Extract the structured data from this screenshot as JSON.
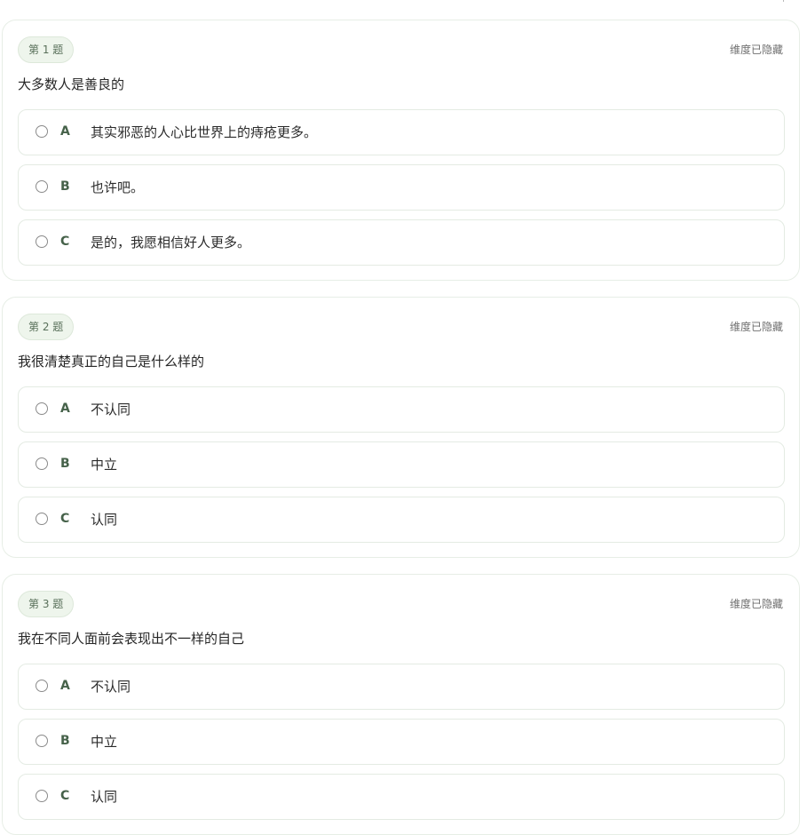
{
  "questions": [
    {
      "badge": "第 1 题",
      "dimension_note": "维度已隐藏",
      "title": "大多数人是善良的",
      "options": [
        {
          "letter": "A",
          "text": "其实邪恶的人心比世界上的痔疮更多。"
        },
        {
          "letter": "B",
          "text": "也许吧。"
        },
        {
          "letter": "C",
          "text": "是的，我愿相信好人更多。"
        }
      ]
    },
    {
      "badge": "第 2 题",
      "dimension_note": "维度已隐藏",
      "title": "我很清楚真正的自己是什么样的",
      "options": [
        {
          "letter": "A",
          "text": "不认同"
        },
        {
          "letter": "B",
          "text": "中立"
        },
        {
          "letter": "C",
          "text": "认同"
        }
      ]
    },
    {
      "badge": "第 3 题",
      "dimension_note": "维度已隐藏",
      "title": "我在不同人面前会表现出不一样的自己",
      "options": [
        {
          "letter": "A",
          "text": "不认同"
        },
        {
          "letter": "B",
          "text": "中立"
        },
        {
          "letter": "C",
          "text": "认同"
        }
      ]
    }
  ],
  "colors": {
    "badge_bg": "#eef5ec",
    "badge_text": "#59705a",
    "letter": "#46624a",
    "card_border": "#e7eee6"
  }
}
